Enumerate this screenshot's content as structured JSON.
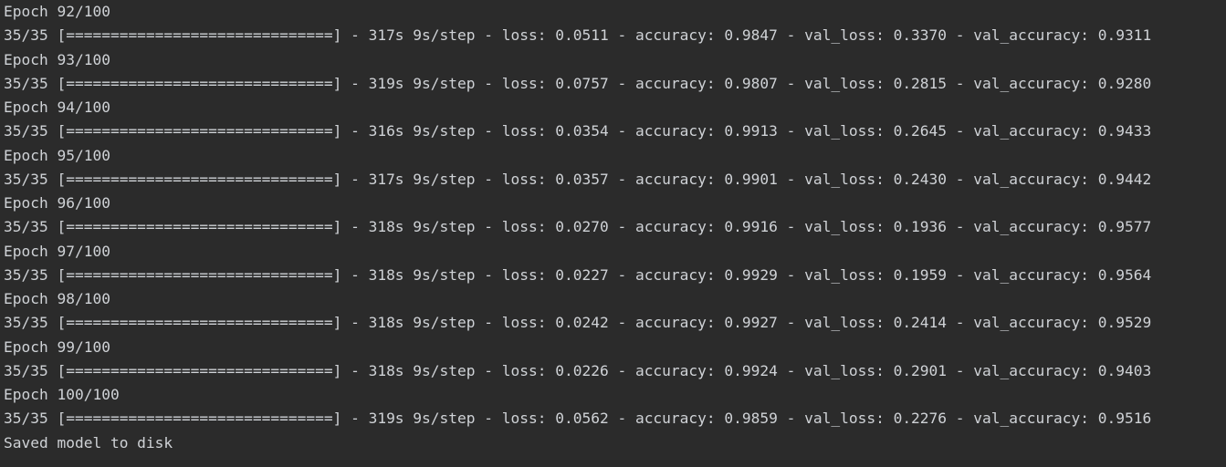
{
  "console": {
    "lines": [
      "Epoch 92/100",
      "35/35 [==============================] - 317s 9s/step - loss: 0.0511 - accuracy: 0.9847 - val_loss: 0.3370 - val_accuracy: 0.9311",
      "Epoch 93/100",
      "35/35 [==============================] - 319s 9s/step - loss: 0.0757 - accuracy: 0.9807 - val_loss: 0.2815 - val_accuracy: 0.9280",
      "Epoch 94/100",
      "35/35 [==============================] - 316s 9s/step - loss: 0.0354 - accuracy: 0.9913 - val_loss: 0.2645 - val_accuracy: 0.9433",
      "Epoch 95/100",
      "35/35 [==============================] - 317s 9s/step - loss: 0.0357 - accuracy: 0.9901 - val_loss: 0.2430 - val_accuracy: 0.9442",
      "Epoch 96/100",
      "35/35 [==============================] - 318s 9s/step - loss: 0.0270 - accuracy: 0.9916 - val_loss: 0.1936 - val_accuracy: 0.9577",
      "Epoch 97/100",
      "35/35 [==============================] - 318s 9s/step - loss: 0.0227 - accuracy: 0.9929 - val_loss: 0.1959 - val_accuracy: 0.9564",
      "Epoch 98/100",
      "35/35 [==============================] - 318s 9s/step - loss: 0.0242 - accuracy: 0.9927 - val_loss: 0.2414 - val_accuracy: 0.9529",
      "Epoch 99/100",
      "35/35 [==============================] - 318s 9s/step - loss: 0.0226 - accuracy: 0.9924 - val_loss: 0.2901 - val_accuracy: 0.9403",
      "Epoch 100/100",
      "35/35 [==============================] - 319s 9s/step - loss: 0.0562 - accuracy: 0.9859 - val_loss: 0.2276 - val_accuracy: 0.9516",
      "Saved model to disk"
    ]
  },
  "colors": {
    "background": "#2b2b2b",
    "text": "#cfd2d6"
  }
}
